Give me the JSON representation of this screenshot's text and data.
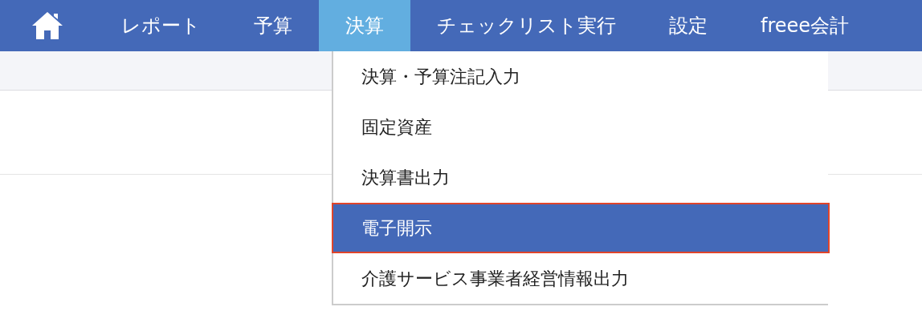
{
  "nav": {
    "tabs": [
      {
        "kind": "home",
        "selected": false
      },
      {
        "kind": "text",
        "label": "レポート",
        "selected": false
      },
      {
        "kind": "text",
        "label": "予算",
        "selected": false
      },
      {
        "kind": "text",
        "label": "決算",
        "selected": true
      },
      {
        "kind": "text",
        "label": "チェックリスト実行",
        "selected": false
      },
      {
        "kind": "text",
        "label": "設定",
        "selected": false
      },
      {
        "kind": "text",
        "label": "freee会計",
        "selected": false
      }
    ]
  },
  "dropdown": {
    "items": [
      {
        "label": "決算・予算注記入力",
        "selected": false
      },
      {
        "label": "固定資産",
        "selected": false
      },
      {
        "label": "決算書出力",
        "selected": false
      },
      {
        "label": "電子開示",
        "selected": true
      },
      {
        "label": "介護サービス事業者経営情報出力",
        "selected": false
      }
    ]
  }
}
